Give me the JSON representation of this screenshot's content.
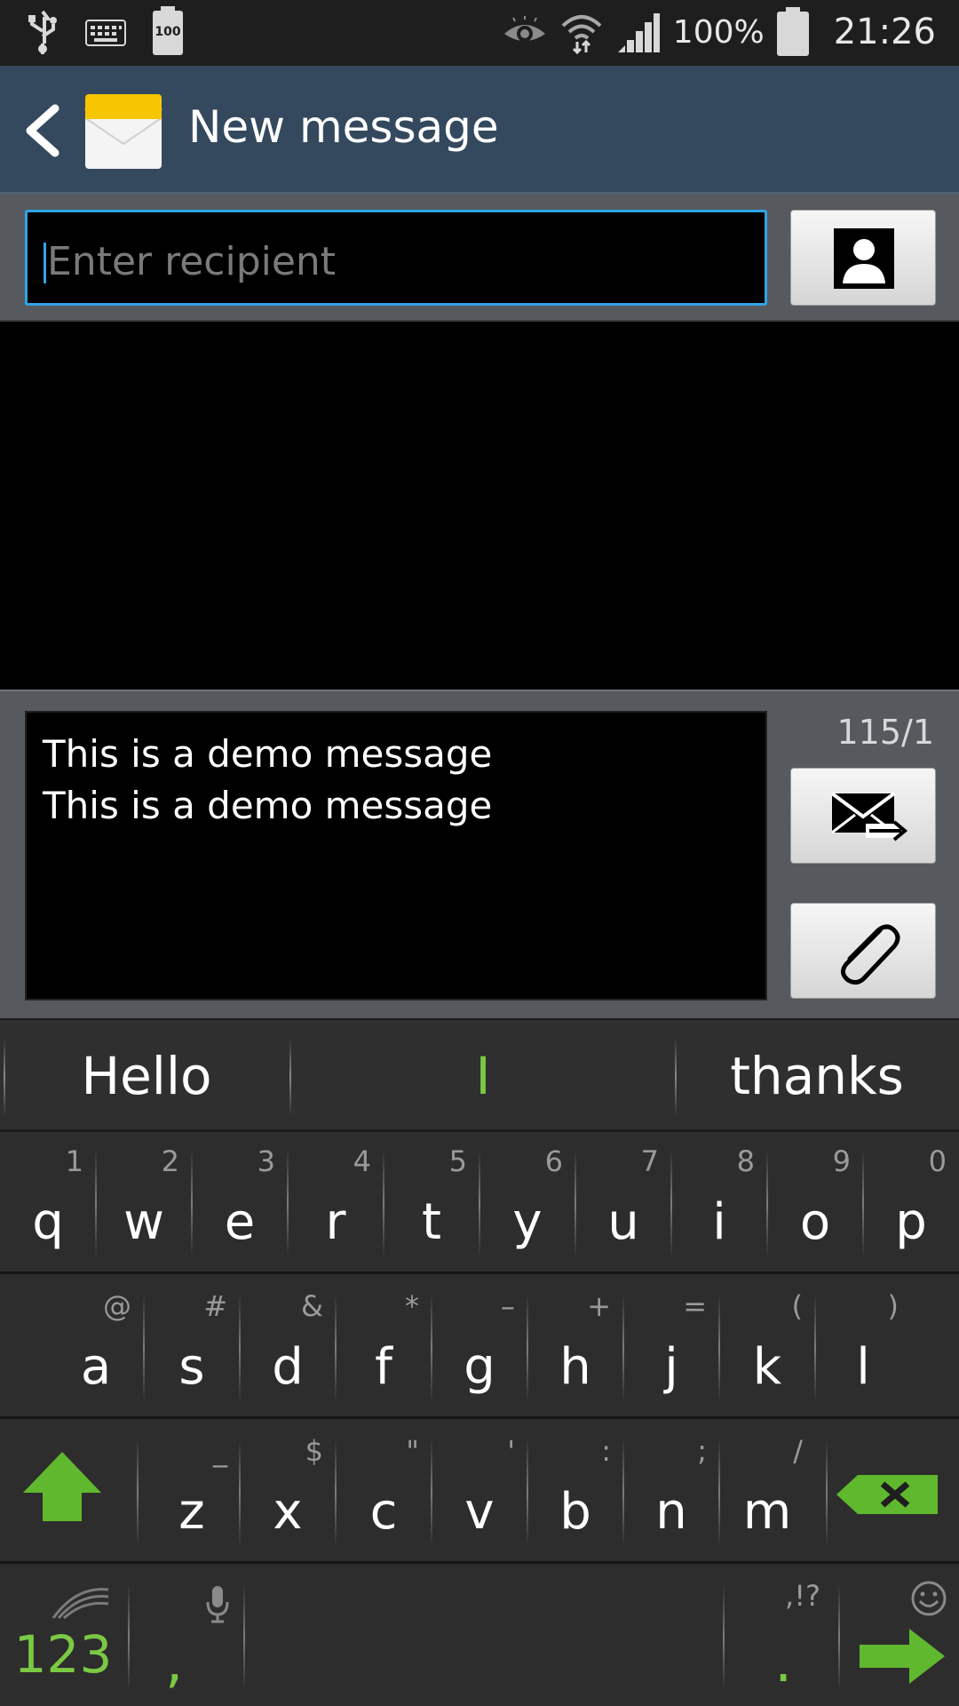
{
  "status_bar": {
    "battery_small": "100",
    "battery_percent": "100%",
    "time": "21:26"
  },
  "action_bar": {
    "title": "New message"
  },
  "recipient": {
    "placeholder": "Enter recipient",
    "value": ""
  },
  "composer": {
    "lines": [
      "This is a demo message",
      "This is a demo message"
    ],
    "counter": "115/1"
  },
  "keyboard": {
    "suggestions": [
      "Hello",
      "I",
      "thanks"
    ],
    "row1": [
      {
        "key": "q",
        "alt": "1"
      },
      {
        "key": "w",
        "alt": "2"
      },
      {
        "key": "e",
        "alt": "3"
      },
      {
        "key": "r",
        "alt": "4"
      },
      {
        "key": "t",
        "alt": "5"
      },
      {
        "key": "y",
        "alt": "6"
      },
      {
        "key": "u",
        "alt": "7"
      },
      {
        "key": "i",
        "alt": "8"
      },
      {
        "key": "o",
        "alt": "9"
      },
      {
        "key": "p",
        "alt": "0"
      }
    ],
    "row2": [
      {
        "key": "a",
        "alt": "@"
      },
      {
        "key": "s",
        "alt": "#"
      },
      {
        "key": "d",
        "alt": "&"
      },
      {
        "key": "f",
        "alt": "*"
      },
      {
        "key": "g",
        "alt": "–"
      },
      {
        "key": "h",
        "alt": "+"
      },
      {
        "key": "j",
        "alt": "="
      },
      {
        "key": "k",
        "alt": "("
      },
      {
        "key": "l",
        "alt": ")"
      }
    ],
    "row3": [
      {
        "key": "z",
        "alt": "_"
      },
      {
        "key": "x",
        "alt": "$"
      },
      {
        "key": "c",
        "alt": "\""
      },
      {
        "key": "v",
        "alt": "'"
      },
      {
        "key": "b",
        "alt": ":"
      },
      {
        "key": "n",
        "alt": ";"
      },
      {
        "key": "m",
        "alt": "/"
      }
    ],
    "numbers_label": "123",
    "comma_label": ",",
    "period_label": ".",
    "period_alt": ",!?",
    "accent_color": "#7ac943"
  },
  "colors": {
    "action_bar": "#34495e",
    "focus": "#2fa4e7",
    "panel": "#56595e"
  }
}
